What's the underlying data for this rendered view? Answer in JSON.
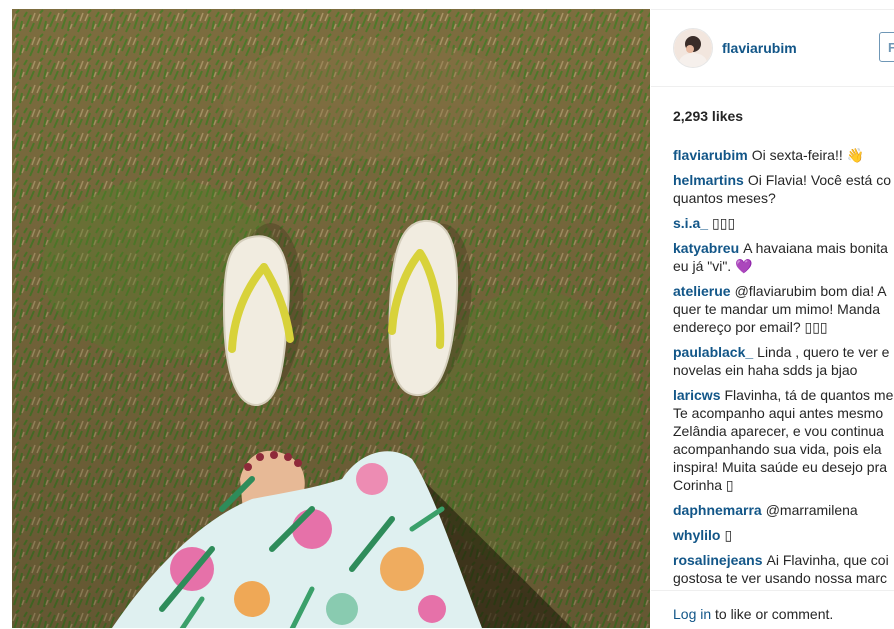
{
  "post": {
    "username": "flaviarubim",
    "follow_label": "F",
    "likes": "2,293 likes",
    "comments": [
      {
        "user": "flaviarubim",
        "text": "Oi sexta-feira!! 👋"
      },
      {
        "user": "helmartins",
        "text": "Oi Flavia! Você está co\nquantos meses?"
      },
      {
        "user": "s.i.a_",
        "text": "▯▯▯"
      },
      {
        "user": "katyabreu",
        "text": "A havaiana mais bonita\neu já \"vi\". 💜"
      },
      {
        "user": "atelierue",
        "text": "@flaviarubim bom dia! A\nquer te mandar um mimo! Manda\nendereço por email? ▯▯▯"
      },
      {
        "user": "paulablack_",
        "text": "Linda , quero te ver e\nnovelas ein haha sdds ja bjao"
      },
      {
        "user": "laricws",
        "text": "Flavinha, tá de quantos me\nTe acompanho aqui antes mesmo\nZelândia aparecer, e vou continua\nacompanhando sua vida, pois ela\ninspira! Muita saúde eu desejo pra\nCorinha ▯"
      },
      {
        "user": "daphnemarra",
        "text": "@marramilena"
      },
      {
        "user": "whylilo",
        "text": "▯"
      },
      {
        "user": "rosalinejeans",
        "text": "Ai Flavinha, que coi\ngostosa te ver usando nossa marc"
      }
    ],
    "login_link": "Log in",
    "login_rest": "to like or comment."
  },
  "colors": {
    "link": "#125688",
    "text": "#262626",
    "grass": "#7a6a3e",
    "sandal": "#f1ece0",
    "strap": "#d8d23a"
  },
  "icons": {
    "avatar": "profile-photo"
  }
}
